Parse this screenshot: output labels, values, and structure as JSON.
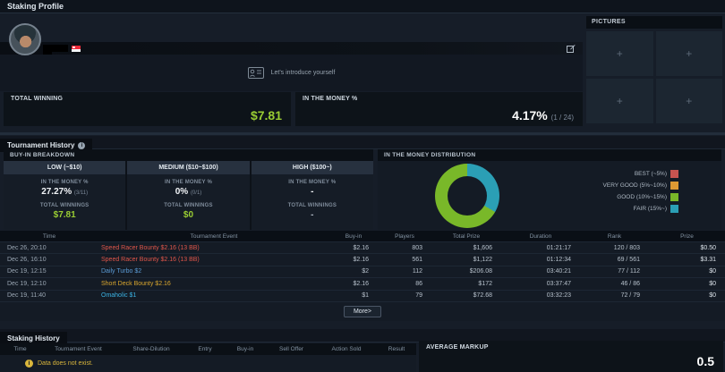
{
  "page_title": "Staking Profile",
  "profile": {
    "intro_text": "Let's introduce yourself",
    "flag": "singapore",
    "stats": {
      "total_winning": {
        "label": "TOTAL WINNING",
        "value": "$7.81",
        "color": "#99cc33"
      },
      "itm": {
        "label": "IN THE MONEY %",
        "value": "4.17%",
        "detail": "(1 / 24)"
      }
    }
  },
  "pictures": {
    "title": "PICTURES",
    "placeholder": "+"
  },
  "tournament_history": {
    "title": "Tournament History",
    "buyin_breakdown": {
      "title": "BUY-IN BREAKDOWN",
      "columns": [
        {
          "header": "LOW (~$10)",
          "itm_label": "IN THE MONEY %",
          "itm_value": "27.27%",
          "itm_detail": "(3/11)",
          "winnings_label": "TOTAL WINNINGS",
          "winnings_value": "$7.81",
          "winnings_color": "#99cc33"
        },
        {
          "header": "MEDIUM ($10~$100)",
          "itm_label": "IN THE MONEY %",
          "itm_value": "0%",
          "itm_detail": "(0/1)",
          "winnings_label": "TOTAL WINNINGS",
          "winnings_value": "$0",
          "winnings_color": "#99cc33"
        },
        {
          "header": "HIGH ($100~)",
          "itm_label": "IN THE MONEY %",
          "itm_value": "-",
          "itm_detail": "",
          "winnings_label": "TOTAL WINNINGS",
          "winnings_value": "-",
          "winnings_color": "#aab4bf"
        }
      ]
    },
    "distribution_title": "IN THE MONEY DISTRIBUTION",
    "table": {
      "headers": [
        "Time",
        "Tournament Event",
        "Buy-in",
        "Players",
        "Total Prize",
        "Duration",
        "Rank",
        "Prize"
      ],
      "rows": [
        {
          "time": "Dec 26, 20:10",
          "event": "Speed Racer Bounty $2.16 (13 BB)",
          "event_color": "#e0564a",
          "buyin": "$2.16",
          "players": "803",
          "total_prize": "$1,606",
          "duration": "01:21:17",
          "rank": "120 / 803",
          "prize": "$0.50"
        },
        {
          "time": "Dec 26, 16:10",
          "event": "Speed Racer Bounty $2.16 (13 BB)",
          "event_color": "#e0564a",
          "buyin": "$2.16",
          "players": "561",
          "total_prize": "$1,122",
          "duration": "01:12:34",
          "rank": "69 / 561",
          "prize": "$3.31"
        },
        {
          "time": "Dec 19, 12:15",
          "event": "Daily Turbo $2",
          "event_color": "#5b9bd5",
          "buyin": "$2",
          "players": "112",
          "total_prize": "$206.08",
          "duration": "03:40:21",
          "rank": "77 / 112",
          "prize": "$0"
        },
        {
          "time": "Dec 19, 12:10",
          "event": "Short Deck Bounty $2.16",
          "event_color": "#d9a62e",
          "buyin": "$2.16",
          "players": "86",
          "total_prize": "$172",
          "duration": "03:37:47",
          "rank": "46 / 86",
          "prize": "$0"
        },
        {
          "time": "Dec 19, 11:40",
          "event": "Omaholic $1",
          "event_color": "#3bb3e4",
          "buyin": "$1",
          "players": "79",
          "total_prize": "$72.68",
          "duration": "03:32:23",
          "rank": "72 / 79",
          "prize": "$0"
        }
      ],
      "more_label": "More>"
    }
  },
  "chart_data": {
    "type": "pie",
    "title": "IN THE MONEY DISTRIBUTION",
    "donut": true,
    "rotation_deg": 120,
    "legend_position": "right",
    "segments": [
      {
        "label": "BEST (~5%)",
        "color": "#c75450",
        "value": 0
      },
      {
        "label": "VERY GOOD (5%~10%)",
        "color": "#dd9933",
        "value": 0
      },
      {
        "label": "GOOD (10%~15%)",
        "color": "#79b829",
        "value": 66.7
      },
      {
        "label": "FAIR (15%~)",
        "color": "#2b9fb5",
        "value": 33.3
      }
    ]
  },
  "staking_history": {
    "title": "Staking History",
    "headers": [
      "Time",
      "Tournament Event",
      "Share-Dilution",
      "Entry",
      "Buy-in",
      "Sell Offer",
      "Action Sold",
      "Result"
    ],
    "empty_message": "Data does not exist.",
    "average_markup": {
      "label": "AVERAGE MARKUP",
      "value": "0.5"
    }
  }
}
